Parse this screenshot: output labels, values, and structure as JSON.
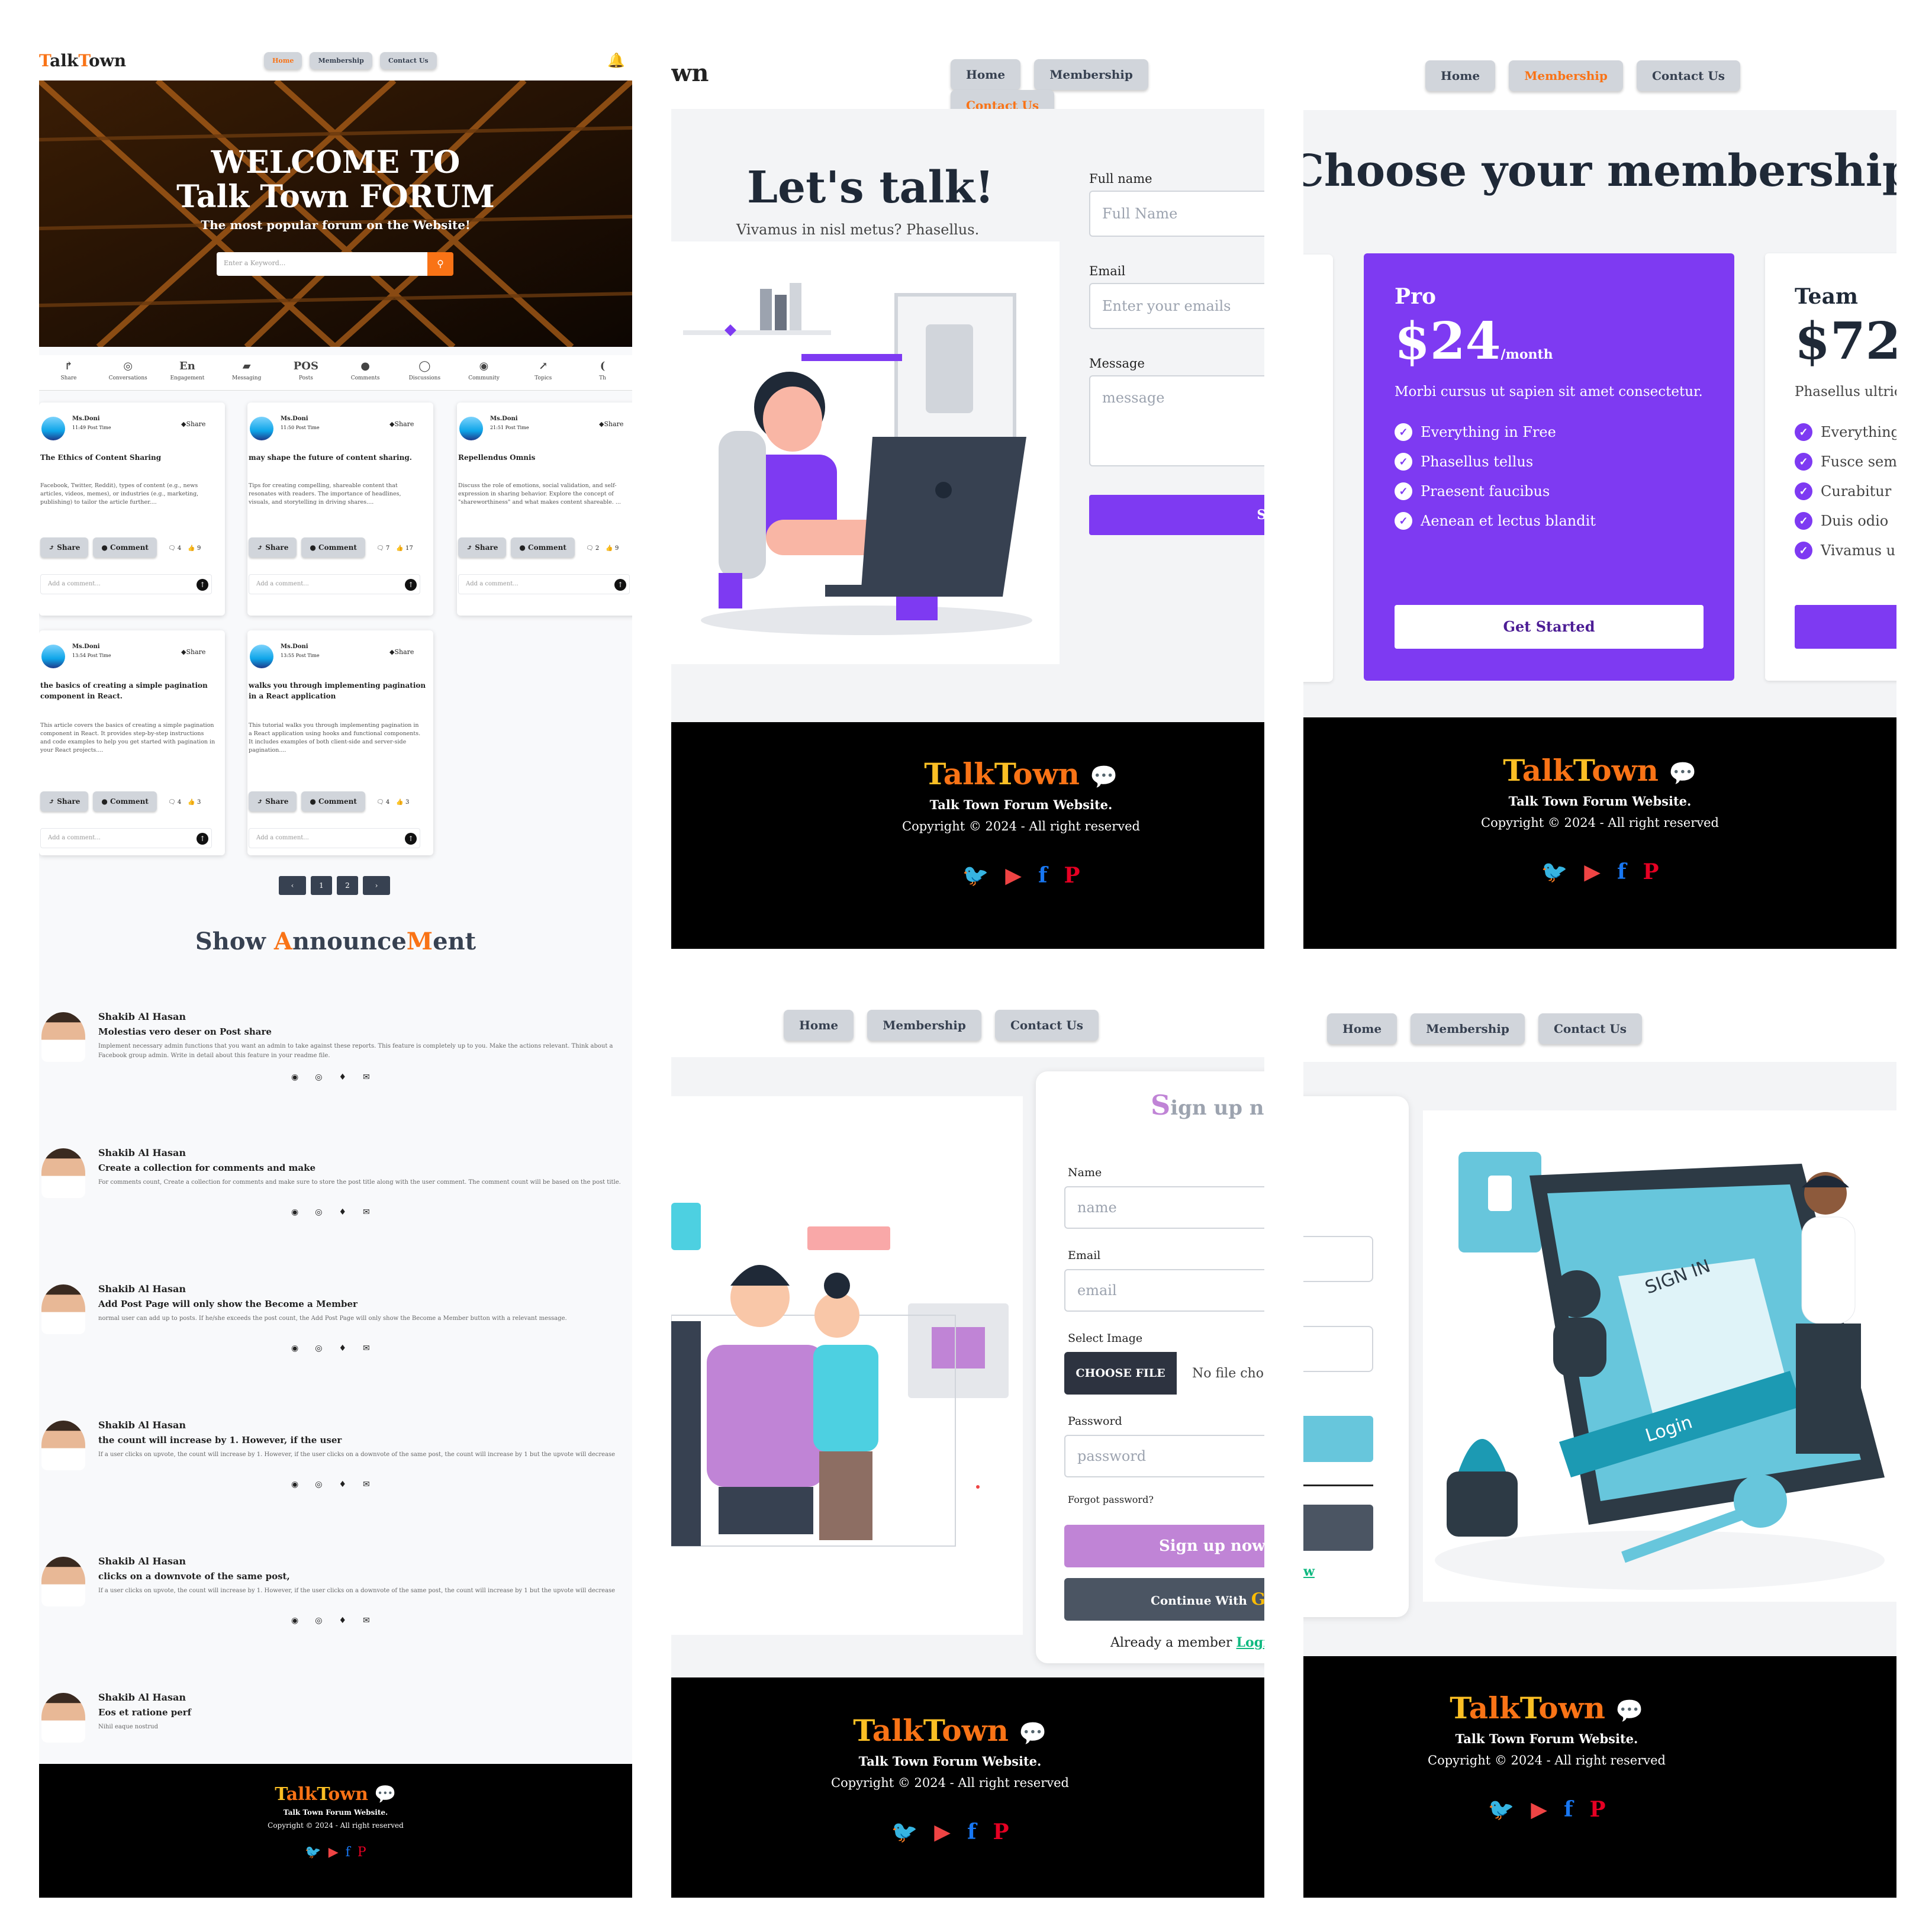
{
  "nav": {
    "home": "Home",
    "membership": "Membership",
    "contact": "Contact Us"
  },
  "p1": {
    "logo": "TalkTown",
    "logo_a": "T",
    "logo_b": "alk",
    "logo_c": "T",
    "logo_d": "own",
    "hero_title1": "WELCOME TO",
    "hero_title2": "Talk Town FORUM",
    "hero_sub": "The most popular forum on the Website!",
    "search_placeholder": "Enter a Keyword...",
    "cats": [
      "Share",
      "Conversations",
      "Engagement",
      "Messaging",
      "Posts",
      "Comments",
      "Discussions",
      "Community",
      "Topics",
      "Th"
    ],
    "cat_glyphs": [
      "↱",
      "◎",
      "En",
      "▰",
      "POS",
      "●",
      "◯",
      "◉",
      "↗",
      "("
    ],
    "posts": [
      {
        "user": "Ms.Doni",
        "time": "11:49 Post Time",
        "title": "The Ethics of Content Sharing",
        "body": "Facebook, Twitter, Reddit), types of content (e.g., news articles, videos, memes), or industries (e.g., marketing, publishing) to tailor the article further....",
        "c": "4",
        "l": "9"
      },
      {
        "user": "Ms.Doni",
        "time": "11:50 Post Time",
        "title": "may shape the future of content sharing.",
        "body": "Tips for creating compelling, shareable content that resonates with readers. The importance of headlines, visuals, and storytelling in driving shares....",
        "c": "7",
        "l": "17"
      },
      {
        "user": "Ms.Doni",
        "time": "21:51 Post Time",
        "title": "Repellendus Omnis",
        "body": "Discuss the role of emotions, social validation, and self-expression in sharing behavior. Explore the concept of \"shareworthiness\" and what makes content shareable. ...",
        "c": "2",
        "l": "9"
      },
      {
        "user": "Ms.Doni",
        "time": "13:54 Post Time",
        "title": "the basics of creating a simple pagination component in React.",
        "body": "This article covers the basics of creating a simple pagination component in React. It provides step-by-step instructions and code examples to help you get started with pagination in your React projects....",
        "c": "4",
        "l": "3"
      },
      {
        "user": "Ms.Doni",
        "time": "13:55 Post Time",
        "title": "walks you through implementing pagination in a React application",
        "body": "This tutorial walks you through implementing pagination in a React application using hooks and functional components. It includes examples of both client-side and server-side pagination....",
        "c": "4",
        "l": "3"
      }
    ],
    "share": "Share",
    "comment": "Comment",
    "share_top": "Share",
    "add_comment": "Add a comment...",
    "pages": [
      "‹",
      "1",
      "2",
      "›"
    ],
    "ann_title_a": "Show ",
    "ann_title_b": "A",
    "ann_title_c": "nnounce",
    "ann_title_d": "M",
    "ann_title_e": "ent",
    "anns": [
      {
        "name": "Shakib Al Hasan",
        "title": "Molestias vero deser on Post share",
        "body": "Implement necessary admin functions that you want an admin to take against these reports. This feature is completely up to you. Make the actions relevant. Think about a Facebook group admin. Write in detail about this feature in your readme file."
      },
      {
        "name": "Shakib Al Hasan",
        "title": "Create a collection for comments and make",
        "body": "For comments count, Create a collection for comments and make sure to store the post title along with the user comment. The comment count will be based on the post title."
      },
      {
        "name": "Shakib Al Hasan",
        "title": "Add Post Page will only show the Become a Member",
        "body": "normal user can add up to posts. If he/she exceeds the post count, the Add Post Page will only show the Become a Member button with a relevant message."
      },
      {
        "name": "Shakib Al Hasan",
        "title": "the count will increase by 1. However, if the user",
        "body": "If a user clicks on upvote, the count will increase by 1. However, if the user clicks on a downvote of the same post, the count will increase by 1 but the upvote will decrease"
      },
      {
        "name": "Shakib Al Hasan",
        "title": "clicks on a downvote of the same post,",
        "body": "If a user clicks on upvote, the count will increase by 1. However, if the user clicks on a downvote of the same post, the count will increase by 1 but the upvote will decrease"
      },
      {
        "name": "Shakib Al Hasan",
        "title": "Eos et ratione perf",
        "body": "Nihil eaque nostrud"
      }
    ]
  },
  "contact": {
    "logo_tail": "wn",
    "title": "Let's talk!",
    "sub": "Vivamus in nisl metus? Phasellus.",
    "full_name_label": "Full name",
    "full_name_ph": "Full Name",
    "email_label": "Email",
    "email_ph": "Enter your emails",
    "message_label": "Message",
    "message_ph": "message",
    "send": "SE"
  },
  "membership": {
    "title": "Choose your membership",
    "pro_name": "Pro",
    "pro_price": "$24",
    "pro_per": "/month",
    "pro_desc": "Morbi cursus ut sapien sit amet consectetur.",
    "pro_features": [
      "Everything in Free",
      "Phasellus tellus",
      "Praesent faucibus",
      "Aenean et lectus blandit"
    ],
    "pro_cta": "Get Started",
    "team_name": "Team",
    "team_price": "$72",
    "team_per": "/",
    "team_desc": "Phasellus ultric",
    "team_features": [
      "Everything",
      "Fusce sem",
      "Curabitur",
      "Duis odio",
      "Vivamus u"
    ]
  },
  "signup": {
    "title_a": "S",
    "title_b": "ign up now!",
    "name_label": "Name",
    "name_ph": "name",
    "email_label": "Email",
    "email_ph": "email",
    "image_label": "Select Image",
    "choose_file": "CHOOSE FILE",
    "no_file": "No file cho",
    "password_label": "Password",
    "password_ph": "password",
    "forgot": "Forgot password?",
    "submit": "Sign up now",
    "google": "Continue With",
    "google_g": "G",
    "already": "Already a member ",
    "login_link": "Logi"
  },
  "login": {
    "login_tail": "w",
    "illus_signin": "SIGN IN",
    "illus_login": "Login"
  },
  "footer": {
    "brand_a": "T",
    "brand_b": "alk",
    "brand_c": "T",
    "brand_d": "own",
    "line1": "Talk Town Forum Website.",
    "line2": "Copyright © 2024 - All right reserved"
  },
  "colors": {
    "purple": "#7e3af2",
    "orange": "#f97316",
    "signup_purple": "#c084d6",
    "twitter": "#1da1f2",
    "youtube": "#ef4444",
    "facebook": "#1877f2",
    "pinterest": "#e60023"
  }
}
